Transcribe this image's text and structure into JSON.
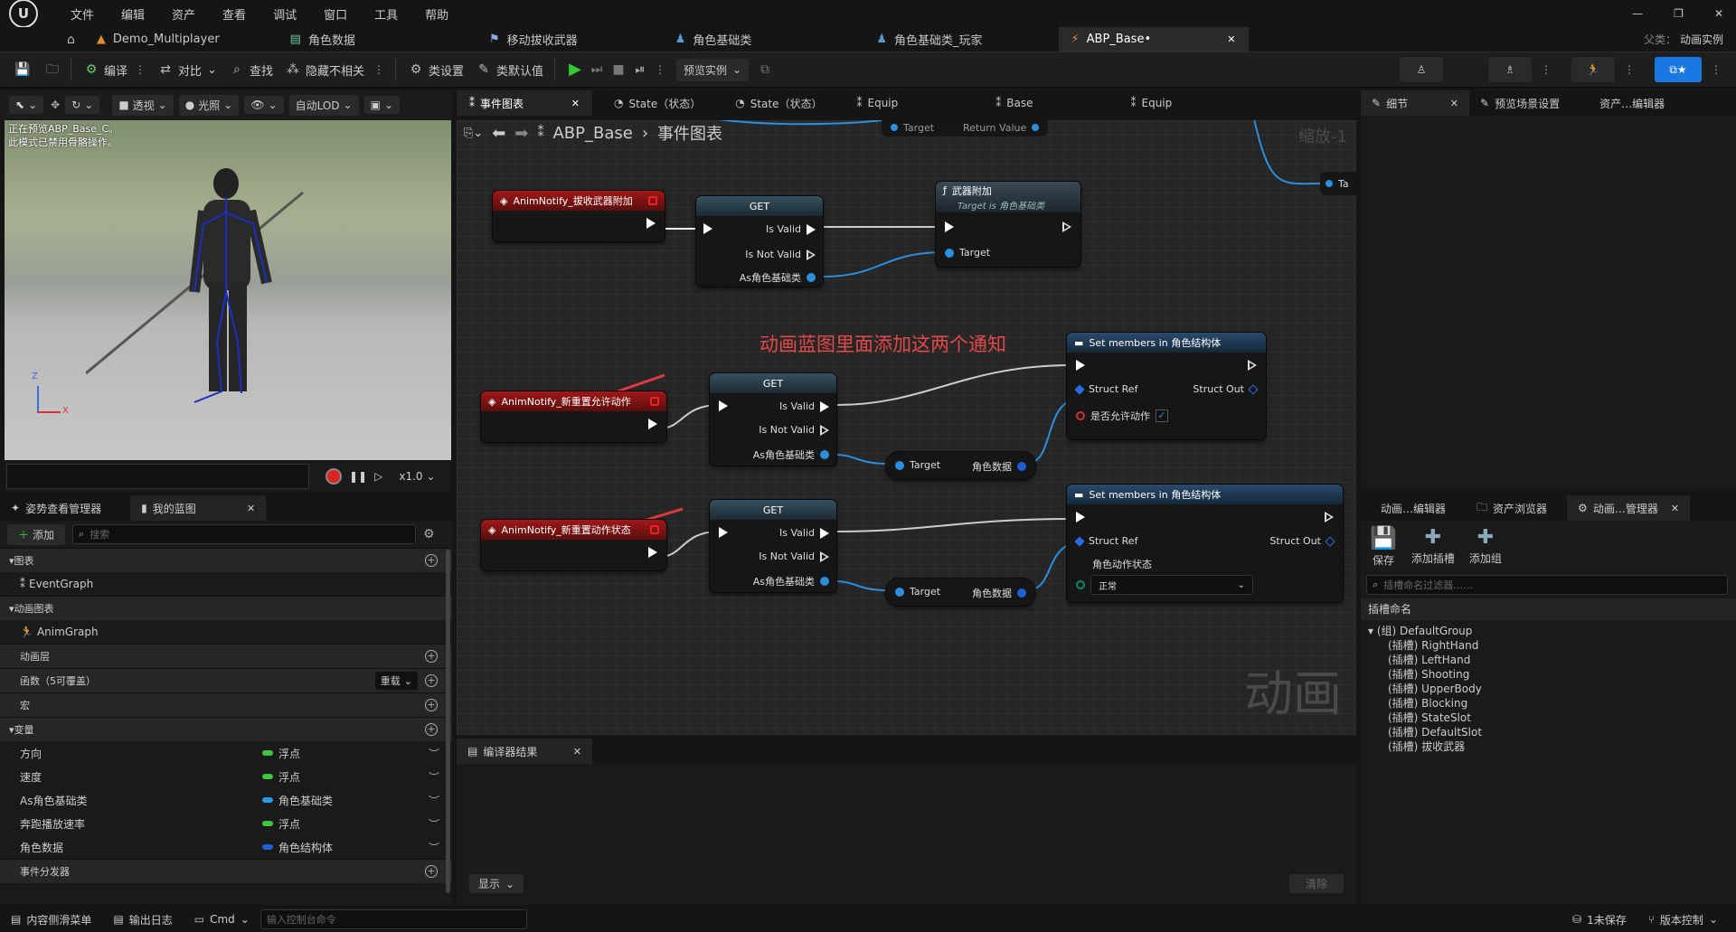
{
  "menu": [
    "文件",
    "编辑",
    "资产",
    "查看",
    "调试",
    "窗口",
    "工具",
    "帮助"
  ],
  "window_controls": {
    "minimize": "—",
    "restore": "❐",
    "close": "✕"
  },
  "tabs": [
    {
      "label": "Demo_Multiplayer"
    },
    {
      "label": "角色数据"
    },
    {
      "label": "移动拔收武器"
    },
    {
      "label": "角色基础类"
    },
    {
      "label": "角色基础类_玩家"
    },
    {
      "label": "ABP_Base•",
      "close": "✕"
    }
  ],
  "parent_class": {
    "label": "父类：",
    "value": "动画实例"
  },
  "toolbar": {
    "compile": "编译",
    "diff": "对比",
    "find": "查找",
    "hide_unrelated": "隐藏不相关",
    "class_settings": "类设置",
    "class_defaults": "类默认值",
    "preview_instance": "预览实例"
  },
  "viewport": {
    "perspective": "透视",
    "lighting": "光照",
    "lod": "自动LOD",
    "notice_line1": "正在预览ABP_Base_C。",
    "notice_line2": "此模式已禁用骨骼操作。",
    "axis_z": "Z",
    "axis_x": "X",
    "speed": "x1.0"
  },
  "left_panel": {
    "tab_pose": "姿势查看管理器",
    "tab_blueprint": "我的蓝图",
    "add": "添加",
    "search_placeholder": "搜索",
    "sec_graphs": "图表",
    "event_graph": "EventGraph",
    "sec_anim_graphs": "动画图表",
    "anim_graph": "AnimGraph",
    "sec_layers": "动画层",
    "sec_functions": "函数（5可覆盖）",
    "override": "重载",
    "sec_macros": "宏",
    "sec_variables": "变量",
    "sec_dispatchers": "事件分发器",
    "variables": [
      {
        "name": "方向",
        "type": "浮点",
        "color": "#3ec43e"
      },
      {
        "name": "速度",
        "type": "浮点",
        "color": "#3ec43e"
      },
      {
        "name": "As角色基础类",
        "type": "角色基础类",
        "color": "#2b9be8"
      },
      {
        "name": "奔跑播放速率",
        "type": "浮点",
        "color": "#3ec43e"
      },
      {
        "name": "角色数据",
        "type": "角色结构体",
        "color": "#1e5fd8"
      }
    ]
  },
  "graph": {
    "tabs": [
      {
        "label": "事件图表",
        "close": "✕"
      },
      {
        "label": "State（状态）"
      },
      {
        "label": "State（状态）"
      },
      {
        "label": "Equip"
      },
      {
        "label": "Base"
      },
      {
        "label": "Equip"
      }
    ],
    "breadcrumb_root": "ABP_Base",
    "breadcrumb_sep": "›",
    "breadcrumb_leaf": "事件图表",
    "zoom": "缩放-1",
    "watermark": "动画",
    "annotation": "动画蓝图里面添加这两个通知",
    "top_pins": {
      "target": "Target",
      "return_value": "Return Value",
      "ta": "Ta"
    },
    "notify1": "AnimNotify_拔收武器附加",
    "notify2": "AnimNotify_新重置允许动作",
    "notify3": "AnimNotify_新重置动作状态",
    "get": "GET",
    "is_valid": "Is Valid",
    "is_not_valid": "Is Not Valid",
    "as_base": "As角色基础类",
    "weapon_attach": "武器附加",
    "weapon_attach_sub": "Target is 角色基础类",
    "target": "Target",
    "char_data": "角色数据",
    "set_members": "Set members in 角色结构体",
    "struct_ref": "Struct Ref",
    "struct_out": "Struct Out",
    "allow_action": "是否允许动作",
    "action_state": "角色动作状态",
    "action_state_value": "正常"
  },
  "compiler": {
    "tab": "编译器结果",
    "close": "✕",
    "show": "显示",
    "clear": "清除"
  },
  "right_top": {
    "tab_details": "细节",
    "tab_preview": "预览场景设置",
    "tab_asset": "资产…编辑器"
  },
  "right_bottom": {
    "tab_anim_editor": "动画…编辑器",
    "tab_asset_browser": "资产浏览器",
    "tab_anim_manager": "动画…管理器",
    "save": "保存",
    "add_socket": "添加插槽",
    "add_group": "添加组",
    "filter_placeholder": "插槽命名过滤器……",
    "header": "插槽命名",
    "group": "(组) DefaultGroup",
    "slots": [
      "(插槽) RightHand",
      "(插槽) LeftHand",
      "(插槽) Shooting",
      "(插槽) UpperBody",
      "(插槽) Blocking",
      "(插槽) StateSlot",
      "(插槽) DefaultSlot",
      "(插槽) 拔收武器"
    ]
  },
  "status": {
    "content_drawer": "内容侧滑菜单",
    "output_log": "输出日志",
    "cmd": "Cmd",
    "console_placeholder": "输入控制台命令",
    "unsaved": "1未保存",
    "source_control": "版本控制"
  }
}
